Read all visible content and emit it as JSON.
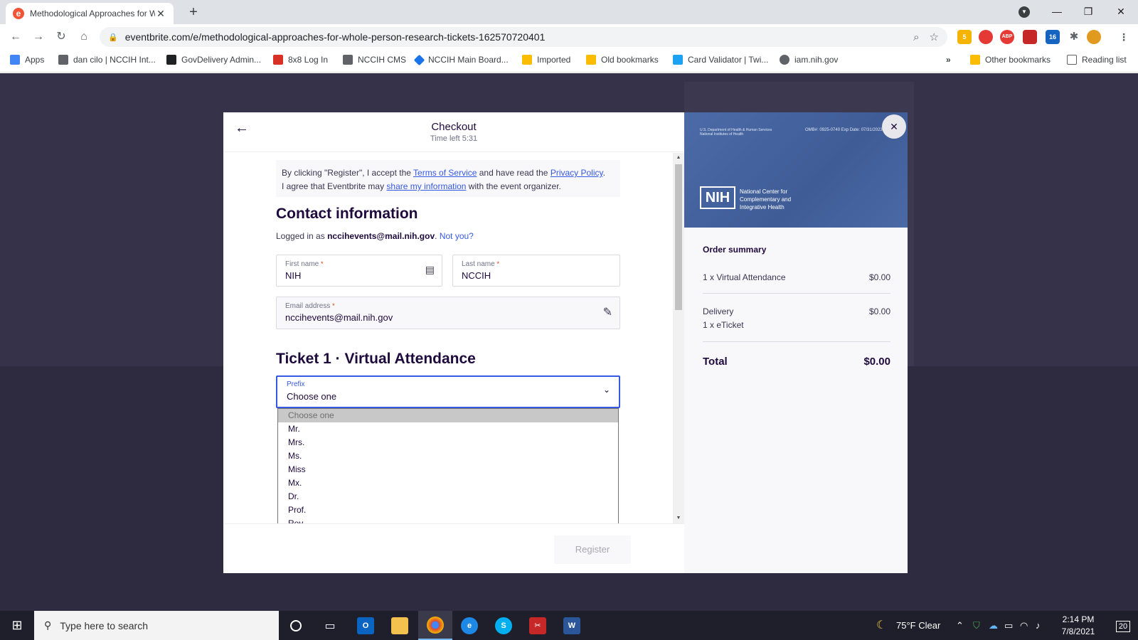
{
  "browser": {
    "tab_title": "Methodological Approaches for W",
    "url": "eventbrite.com/e/methodological-approaches-for-whole-person-research-tickets-162570720401",
    "bookmarks": [
      {
        "label": "Apps",
        "color": "#4285f4"
      },
      {
        "label": "dan cilo | NCCIH Int...",
        "color": "#5f6368"
      },
      {
        "label": "GovDelivery Admin...",
        "color": "#202124"
      },
      {
        "label": "8x8 Log In",
        "color": "#d93025"
      },
      {
        "label": "NCCIH CMS",
        "color": "#5f6368"
      },
      {
        "label": "NCCIH Main Board...",
        "color": "#1a73e8"
      },
      {
        "label": "Imported",
        "color": "#fbbc04"
      },
      {
        "label": "Old bookmarks",
        "color": "#fbbc04"
      },
      {
        "label": "Card Validator | Twi...",
        "color": "#1da1f2"
      },
      {
        "label": "iam.nih.gov",
        "color": "#5f6368"
      }
    ],
    "other_bookmarks": "Other bookmarks",
    "reading_list": "Reading list",
    "ext_badges": {
      "first": "5",
      "second": "16",
      "abp": "ABP"
    }
  },
  "checkout": {
    "title": "Checkout",
    "time_left": "Time left 5:31",
    "terms": {
      "t1": "By clicking \"Register\", I accept the ",
      "l1": "Terms of Service",
      "t2": " and have read the ",
      "l2": "Privacy Policy",
      "t3": ".",
      "t4": "I agree that Eventbrite may ",
      "l3": "share my information",
      "t5": " with the event organizer."
    },
    "contact_heading": "Contact information",
    "logged_prefix": "Logged in as ",
    "logged_email": "nccihevents@mail.nih.gov",
    "not_you": "Not you?",
    "first_name_label": "First name",
    "first_name_value": "NIH",
    "last_name_label": "Last name",
    "last_name_value": "NCCIH",
    "email_label": "Email address",
    "email_value": "nccihevents@mail.nih.gov",
    "required_mark": "*",
    "ticket_heading": "Ticket 1 · Virtual Attendance",
    "prefix_label": "Prefix",
    "prefix_value": "Choose one",
    "prefix_options": [
      "Choose one",
      "Mr.",
      "Mrs.",
      "Ms.",
      "Miss",
      "Mx.",
      "Dr.",
      "Prof.",
      "Rev."
    ],
    "register_label": "Register"
  },
  "banner": {
    "dept": "U.S. Department of Health & Human Services National Institutes of Health",
    "omb": "OMB#: 0925-0740 Exp Date: 07/31/2023",
    "nih": "NIH",
    "center": "National Center for Complementary and Integrative Health"
  },
  "order_summary": {
    "title": "Order summary",
    "item_label": "1 x Virtual Attendance",
    "item_amount": "$0.00",
    "delivery_label": "Delivery",
    "delivery_amount": "$0.00",
    "delivery_sub": "1 x eTicket",
    "total_label": "Total",
    "total_amount": "$0.00"
  },
  "taskbar": {
    "search_placeholder": "Type here to search",
    "weather": "75°F  Clear",
    "time": "2:14 PM",
    "date": "7/8/2021",
    "notifications": "20"
  }
}
